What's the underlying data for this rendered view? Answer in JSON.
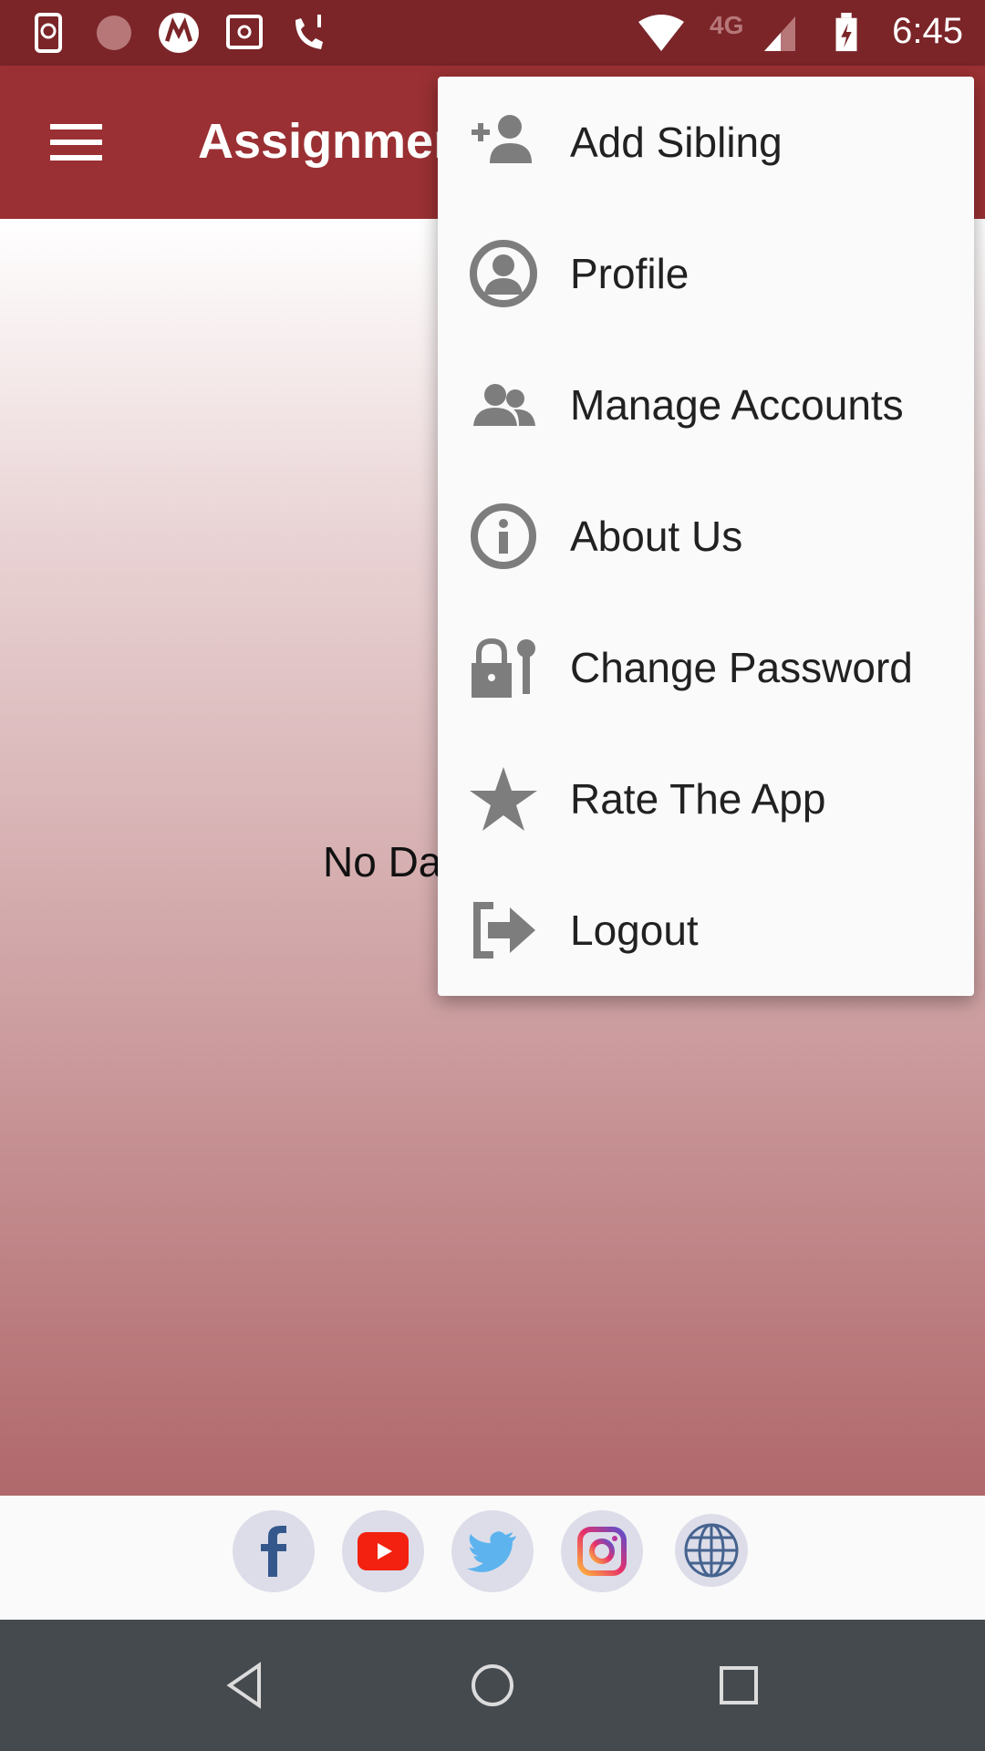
{
  "status_bar": {
    "time": "6:45",
    "network": "4G",
    "icons": [
      "phone-sync-icon",
      "loading-icon",
      "motorola-icon",
      "safe-icon",
      "wifi-calling-icon",
      "wifi-icon",
      "signal-icon",
      "battery-charging-icon"
    ]
  },
  "app_bar": {
    "title": "Assignments",
    "menu_icon": "hamburger-icon"
  },
  "content": {
    "empty_text": "No Data Found"
  },
  "overflow_menu": {
    "items": [
      {
        "label": "Add Sibling",
        "icon": "add-person-icon"
      },
      {
        "label": "Profile",
        "icon": "profile-icon"
      },
      {
        "label": "Manage Accounts",
        "icon": "people-icon"
      },
      {
        "label": "About Us",
        "icon": "info-icon"
      },
      {
        "label": "Change Password",
        "icon": "lock-key-icon"
      },
      {
        "label": "Rate The App",
        "icon": "star-icon"
      },
      {
        "label": "Logout",
        "icon": "logout-icon"
      }
    ]
  },
  "footer": {
    "social": [
      "facebook",
      "youtube",
      "twitter",
      "instagram",
      "website"
    ]
  },
  "colors": {
    "status_bar": "#7b2529",
    "app_bar": "#9a3033",
    "menu_icon": "#7d7d7d",
    "nav_bar": "#454a4f"
  }
}
